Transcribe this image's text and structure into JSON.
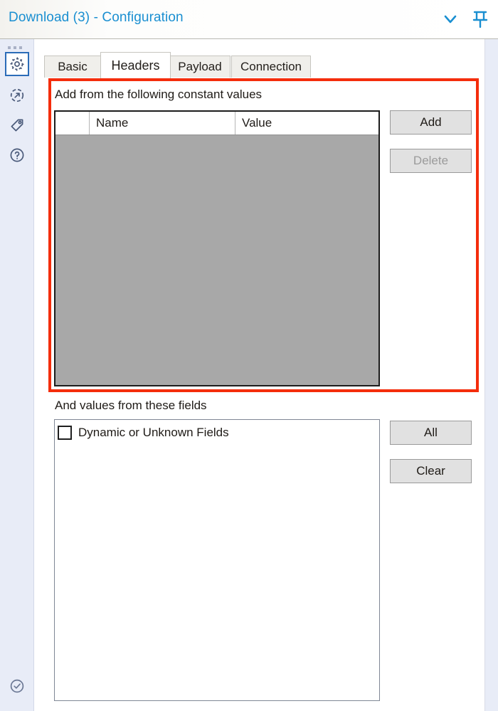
{
  "window": {
    "title": "Download (3) - Configuration",
    "collapse_icon": "chevron-down-icon",
    "pin_icon": "pin-icon"
  },
  "sidebar": {
    "overflow_icon": "ellipsis-icon",
    "items": [
      {
        "icon": "gear-icon",
        "name": "configuration",
        "selected": true
      },
      {
        "icon": "share-circle-icon",
        "name": "output",
        "selected": false
      },
      {
        "icon": "tag-icon",
        "name": "annotation",
        "selected": false
      },
      {
        "icon": "question-circle-icon",
        "name": "help",
        "selected": false
      }
    ],
    "footer": {
      "icon": "check-circle-icon",
      "name": "status"
    }
  },
  "tabs": [
    {
      "label": "Basic",
      "active": false
    },
    {
      "label": "Headers",
      "active": true
    },
    {
      "label": "Payload",
      "active": false
    },
    {
      "label": "Connection",
      "active": false
    }
  ],
  "constants_section": {
    "label": "Add from the following constant values",
    "columns": [
      "",
      "Name",
      "Value"
    ],
    "rows": [],
    "buttons": [
      {
        "label": "Add",
        "disabled": false
      },
      {
        "label": "Delete",
        "disabled": true
      }
    ]
  },
  "fields_section": {
    "label": "And values from these fields",
    "items": [
      {
        "label": "Dynamic or Unknown Fields",
        "checked": false
      }
    ],
    "buttons": [
      {
        "label": "All",
        "disabled": false
      },
      {
        "label": "Clear",
        "disabled": false
      }
    ]
  },
  "annotation": {
    "highlight_color": "#f42d0c"
  },
  "colors": {
    "title_text": "#1a8fd1",
    "sidebar_bg": "#e8ecf7",
    "panel_bg": "#ffffff",
    "grid_body": "#a8a8a8",
    "button_face": "#e1e1e1"
  }
}
